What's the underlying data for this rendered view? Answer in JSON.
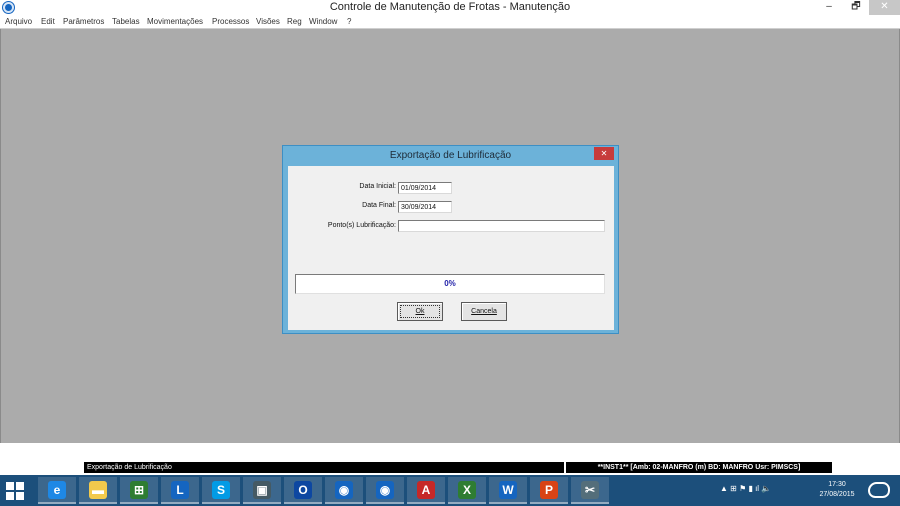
{
  "window": {
    "title": "Controle de Manutenção de Frotas - Manutenção",
    "minimize": "–",
    "restore": "🗗",
    "close": "✕"
  },
  "menu": [
    "Arquivo",
    "Edit",
    "Parâmetros",
    "Tabelas",
    "Movimentações",
    "Processos",
    "Visões",
    "Reg",
    "Window",
    "?"
  ],
  "dialog": {
    "title": "Exportação de Lubrificação",
    "close": "✕",
    "fields": {
      "data_inicial_label": "Data Inicial:",
      "data_inicial_value": "01/09/2014",
      "data_final_label": "Data Final:",
      "data_final_value": "30/09/2014",
      "ponto_label": "Ponto(s) Lubrificação:",
      "ponto_value": ""
    },
    "progress": {
      "value": 0,
      "text": "0%"
    },
    "buttons": {
      "ok": "Ok",
      "cancel": "Cancela"
    }
  },
  "statusbar": {
    "left": "Exportação de Lubrificação",
    "right": "**INST1**  [Amb: 02-MANFRO  (m) BD: MANFRO Usr: PIMSCS]"
  },
  "taskbar": {
    "apps": [
      {
        "name": "internet-explorer-icon",
        "glyph": "e",
        "color": "#1e88e5"
      },
      {
        "name": "file-explorer-icon",
        "glyph": "▬",
        "color": "#f2c94c"
      },
      {
        "name": "store-icon",
        "glyph": "⊞",
        "color": "#2e7d32"
      },
      {
        "name": "lync-icon",
        "glyph": "L",
        "color": "#1565c0"
      },
      {
        "name": "skype-icon",
        "glyph": "S",
        "color": "#039be5"
      },
      {
        "name": "remote-desktop-icon",
        "glyph": "▣",
        "color": "#455a64"
      },
      {
        "name": "outlook-icon",
        "glyph": "O",
        "color": "#0d47a1"
      },
      {
        "name": "app-circle-icon",
        "glyph": "◉",
        "color": "#1565c0"
      },
      {
        "name": "app-circle-active-icon",
        "glyph": "◉",
        "color": "#1565c0"
      },
      {
        "name": "acrobat-icon",
        "glyph": "A",
        "color": "#c62828"
      },
      {
        "name": "excel-icon",
        "glyph": "X",
        "color": "#2e7d32"
      },
      {
        "name": "word-icon",
        "glyph": "W",
        "color": "#1565c0"
      },
      {
        "name": "powerpoint-icon",
        "glyph": "P",
        "color": "#d84315"
      },
      {
        "name": "snipping-tool-icon",
        "glyph": "✂",
        "color": "#546e7a"
      }
    ],
    "tray": "▲ ⊞ ⚑ ▮ ıl 🔈",
    "time": "17:30",
    "date": "27/08/2015"
  }
}
